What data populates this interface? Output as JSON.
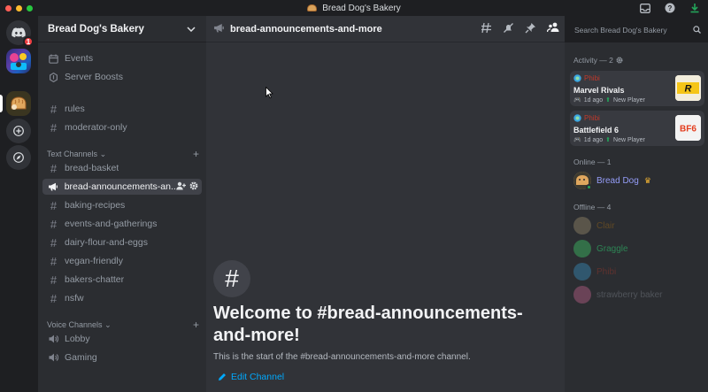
{
  "window": {
    "title": "Bread Dog's Bakery"
  },
  "rail": {
    "home_badge": "1"
  },
  "guild": {
    "name": "Bread Dog's Bakery"
  },
  "top_items": [
    {
      "label": "Events"
    },
    {
      "label": "Server Boosts"
    }
  ],
  "misc_channels": [
    {
      "label": "rules"
    },
    {
      "label": "moderator-only"
    }
  ],
  "text_category": "Text Channels",
  "text_channels": [
    {
      "label": "bread-basket"
    },
    {
      "label": "bread-announcements-an..."
    },
    {
      "label": "baking-recipes"
    },
    {
      "label": "events-and-gatherings"
    },
    {
      "label": "dairy-flour-and-eggs"
    },
    {
      "label": "vegan-friendly"
    },
    {
      "label": "bakers-chatter"
    },
    {
      "label": "nsfw"
    }
  ],
  "voice_category": "Voice Channels",
  "voice_channels": [
    {
      "label": "Lobby"
    },
    {
      "label": "Gaming"
    }
  ],
  "chat": {
    "title": "bread-announcements-and-more",
    "welcome_title": "Welcome to #bread-announcements-and-more!",
    "welcome_sub": "This is the start of the #bread-announcements-and-more channel.",
    "edit_label": "Edit Channel"
  },
  "search": {
    "placeholder": "Search Bread Dog's Bakery"
  },
  "members": {
    "activity_label": "Activity — 2",
    "activities": [
      {
        "user": "Phibi",
        "game": "Marvel Rivals",
        "time": "1d ago",
        "tag": "New Player",
        "thumb": "R"
      },
      {
        "user": "Phibi",
        "game": "Battlefield 6",
        "time": "1d ago",
        "tag": "New Player",
        "thumb": "BF6"
      }
    ],
    "online_label": "Online — 1",
    "online": [
      {
        "name": "Bread Dog"
      }
    ],
    "offline_label": "Offline — 4",
    "offline": [
      {
        "name": "Clair"
      },
      {
        "name": "Graggle"
      },
      {
        "name": "Phibi"
      },
      {
        "name": "strawberry baker"
      }
    ]
  },
  "colors": {
    "accent": "#5865f2",
    "link": "#00a8fc",
    "online_name": "#949cf7",
    "graggle": "#2ecc71",
    "phibi": "#c0392b"
  }
}
